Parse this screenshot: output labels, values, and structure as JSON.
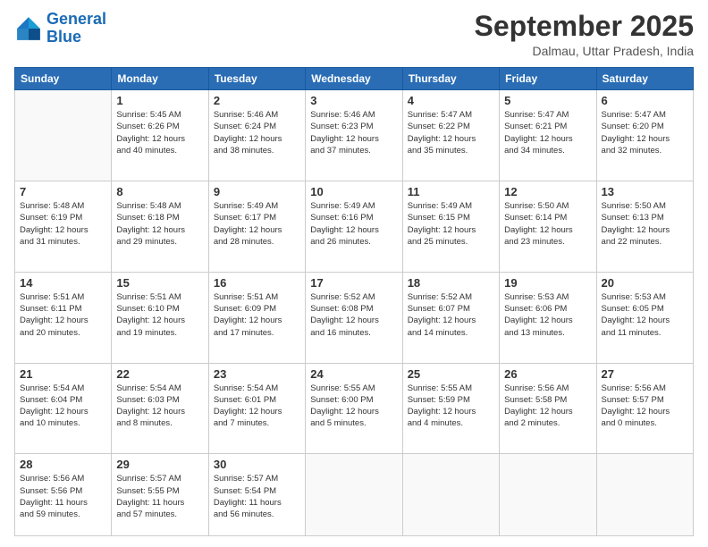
{
  "header": {
    "logo_general": "General",
    "logo_blue": "Blue",
    "month_title": "September 2025",
    "location": "Dalmau, Uttar Pradesh, India"
  },
  "days_of_week": [
    "Sunday",
    "Monday",
    "Tuesday",
    "Wednesday",
    "Thursday",
    "Friday",
    "Saturday"
  ],
  "weeks": [
    [
      {
        "day": "",
        "info": ""
      },
      {
        "day": "1",
        "info": "Sunrise: 5:45 AM\nSunset: 6:26 PM\nDaylight: 12 hours\nand 40 minutes."
      },
      {
        "day": "2",
        "info": "Sunrise: 5:46 AM\nSunset: 6:24 PM\nDaylight: 12 hours\nand 38 minutes."
      },
      {
        "day": "3",
        "info": "Sunrise: 5:46 AM\nSunset: 6:23 PM\nDaylight: 12 hours\nand 37 minutes."
      },
      {
        "day": "4",
        "info": "Sunrise: 5:47 AM\nSunset: 6:22 PM\nDaylight: 12 hours\nand 35 minutes."
      },
      {
        "day": "5",
        "info": "Sunrise: 5:47 AM\nSunset: 6:21 PM\nDaylight: 12 hours\nand 34 minutes."
      },
      {
        "day": "6",
        "info": "Sunrise: 5:47 AM\nSunset: 6:20 PM\nDaylight: 12 hours\nand 32 minutes."
      }
    ],
    [
      {
        "day": "7",
        "info": "Sunrise: 5:48 AM\nSunset: 6:19 PM\nDaylight: 12 hours\nand 31 minutes."
      },
      {
        "day": "8",
        "info": "Sunrise: 5:48 AM\nSunset: 6:18 PM\nDaylight: 12 hours\nand 29 minutes."
      },
      {
        "day": "9",
        "info": "Sunrise: 5:49 AM\nSunset: 6:17 PM\nDaylight: 12 hours\nand 28 minutes."
      },
      {
        "day": "10",
        "info": "Sunrise: 5:49 AM\nSunset: 6:16 PM\nDaylight: 12 hours\nand 26 minutes."
      },
      {
        "day": "11",
        "info": "Sunrise: 5:49 AM\nSunset: 6:15 PM\nDaylight: 12 hours\nand 25 minutes."
      },
      {
        "day": "12",
        "info": "Sunrise: 5:50 AM\nSunset: 6:14 PM\nDaylight: 12 hours\nand 23 minutes."
      },
      {
        "day": "13",
        "info": "Sunrise: 5:50 AM\nSunset: 6:13 PM\nDaylight: 12 hours\nand 22 minutes."
      }
    ],
    [
      {
        "day": "14",
        "info": "Sunrise: 5:51 AM\nSunset: 6:11 PM\nDaylight: 12 hours\nand 20 minutes."
      },
      {
        "day": "15",
        "info": "Sunrise: 5:51 AM\nSunset: 6:10 PM\nDaylight: 12 hours\nand 19 minutes."
      },
      {
        "day": "16",
        "info": "Sunrise: 5:51 AM\nSunset: 6:09 PM\nDaylight: 12 hours\nand 17 minutes."
      },
      {
        "day": "17",
        "info": "Sunrise: 5:52 AM\nSunset: 6:08 PM\nDaylight: 12 hours\nand 16 minutes."
      },
      {
        "day": "18",
        "info": "Sunrise: 5:52 AM\nSunset: 6:07 PM\nDaylight: 12 hours\nand 14 minutes."
      },
      {
        "day": "19",
        "info": "Sunrise: 5:53 AM\nSunset: 6:06 PM\nDaylight: 12 hours\nand 13 minutes."
      },
      {
        "day": "20",
        "info": "Sunrise: 5:53 AM\nSunset: 6:05 PM\nDaylight: 12 hours\nand 11 minutes."
      }
    ],
    [
      {
        "day": "21",
        "info": "Sunrise: 5:54 AM\nSunset: 6:04 PM\nDaylight: 12 hours\nand 10 minutes."
      },
      {
        "day": "22",
        "info": "Sunrise: 5:54 AM\nSunset: 6:03 PM\nDaylight: 12 hours\nand 8 minutes."
      },
      {
        "day": "23",
        "info": "Sunrise: 5:54 AM\nSunset: 6:01 PM\nDaylight: 12 hours\nand 7 minutes."
      },
      {
        "day": "24",
        "info": "Sunrise: 5:55 AM\nSunset: 6:00 PM\nDaylight: 12 hours\nand 5 minutes."
      },
      {
        "day": "25",
        "info": "Sunrise: 5:55 AM\nSunset: 5:59 PM\nDaylight: 12 hours\nand 4 minutes."
      },
      {
        "day": "26",
        "info": "Sunrise: 5:56 AM\nSunset: 5:58 PM\nDaylight: 12 hours\nand 2 minutes."
      },
      {
        "day": "27",
        "info": "Sunrise: 5:56 AM\nSunset: 5:57 PM\nDaylight: 12 hours\nand 0 minutes."
      }
    ],
    [
      {
        "day": "28",
        "info": "Sunrise: 5:56 AM\nSunset: 5:56 PM\nDaylight: 11 hours\nand 59 minutes."
      },
      {
        "day": "29",
        "info": "Sunrise: 5:57 AM\nSunset: 5:55 PM\nDaylight: 11 hours\nand 57 minutes."
      },
      {
        "day": "30",
        "info": "Sunrise: 5:57 AM\nSunset: 5:54 PM\nDaylight: 11 hours\nand 56 minutes."
      },
      {
        "day": "",
        "info": ""
      },
      {
        "day": "",
        "info": ""
      },
      {
        "day": "",
        "info": ""
      },
      {
        "day": "",
        "info": ""
      }
    ]
  ]
}
